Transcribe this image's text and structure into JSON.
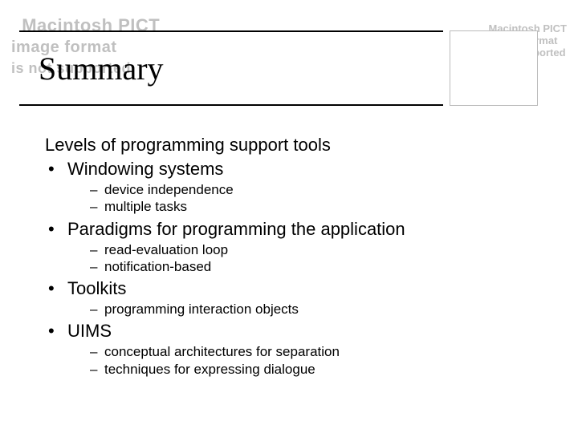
{
  "warnings": {
    "top_line1": "Macintosh PICT",
    "top_line2": "image format",
    "top_line3": "is not supported",
    "side_line1": "Macintosh PICT",
    "side_line2": "image format",
    "side_line3": "is not supported"
  },
  "title": "Summary",
  "intro": "Levels of programming support tools",
  "bullets": [
    {
      "label": "Windowing systems",
      "subs": [
        "device independence",
        "multiple tasks"
      ]
    },
    {
      "label": "Paradigms for programming the application",
      "subs": [
        "read-evaluation loop",
        "notification-based"
      ]
    },
    {
      "label": "Toolkits",
      "subs": [
        "programming interaction objects"
      ]
    },
    {
      "label": "UIMS",
      "subs": [
        "conceptual architectures for separation",
        "techniques for expressing dialogue"
      ]
    }
  ]
}
